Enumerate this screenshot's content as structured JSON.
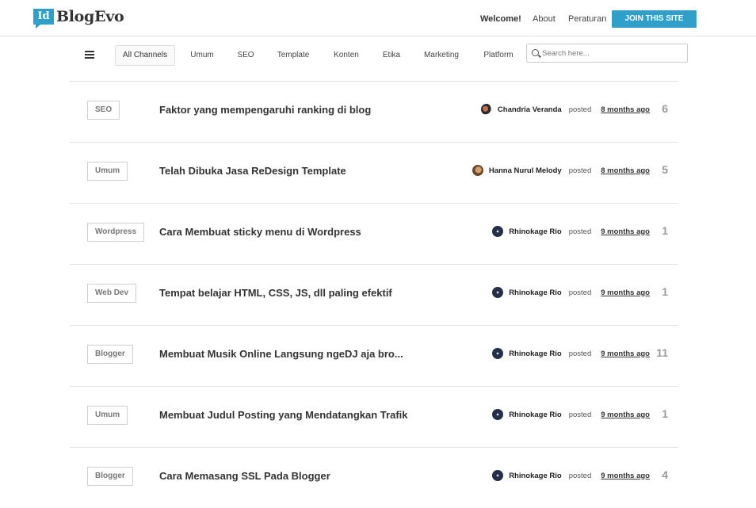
{
  "logo": {
    "badge": "Id",
    "name": "BlogEvo"
  },
  "nav": {
    "welcome": "Welcome!",
    "about": "About",
    "rules": "Peraturan",
    "join": "JOIN THIS SITE"
  },
  "channels": [
    "All Channels",
    "Umum",
    "SEO",
    "Template",
    "Konten",
    "Etika",
    "Marketing",
    "Platform"
  ],
  "search": {
    "placeholder": "Search here..."
  },
  "posted_label": "posted",
  "threads": [
    {
      "tag": "SEO",
      "title": "Faktor yang mempengaruhi ranking di blog",
      "author": "Chandria Veranda",
      "avatar": "chandria",
      "time": "8 months ago",
      "count": "6"
    },
    {
      "tag": "Umum",
      "title": "Telah Dibuka Jasa ReDesign Template",
      "author": "Hanna Nurul Melody",
      "avatar": "hanna",
      "time": "8 months ago",
      "count": "5"
    },
    {
      "tag": "Wordpress",
      "title": "Cara Membuat sticky menu di Wordpress",
      "author": "Rhinokage Rio",
      "avatar": "rhino",
      "time": "9 months ago",
      "count": "1"
    },
    {
      "tag": "Web Dev",
      "title": "Tempat belajar HTML, CSS, JS, dll paling efektif",
      "author": "Rhinokage Rio",
      "avatar": "rhino",
      "time": "9 months ago",
      "count": "1"
    },
    {
      "tag": "Blogger",
      "title": "Membuat Musik Online Langsung ngeDJ aja bro...",
      "author": "Rhinokage Rio",
      "avatar": "rhino",
      "time": "9 months ago",
      "count": "11"
    },
    {
      "tag": "Umum",
      "title": "Membuat Judul Posting yang Mendatangkan Trafik",
      "author": "Rhinokage Rio",
      "avatar": "rhino",
      "time": "9 months ago",
      "count": "1"
    },
    {
      "tag": "Blogger",
      "title": "Cara Memasang SSL Pada Blogger",
      "author": "Rhinokage Rio",
      "avatar": "rhino",
      "time": "9 months ago",
      "count": "4"
    }
  ],
  "colors": {
    "accent": "#2fa0c9",
    "text": "#333333",
    "muted": "#999999",
    "border": "#e3e3e3"
  }
}
